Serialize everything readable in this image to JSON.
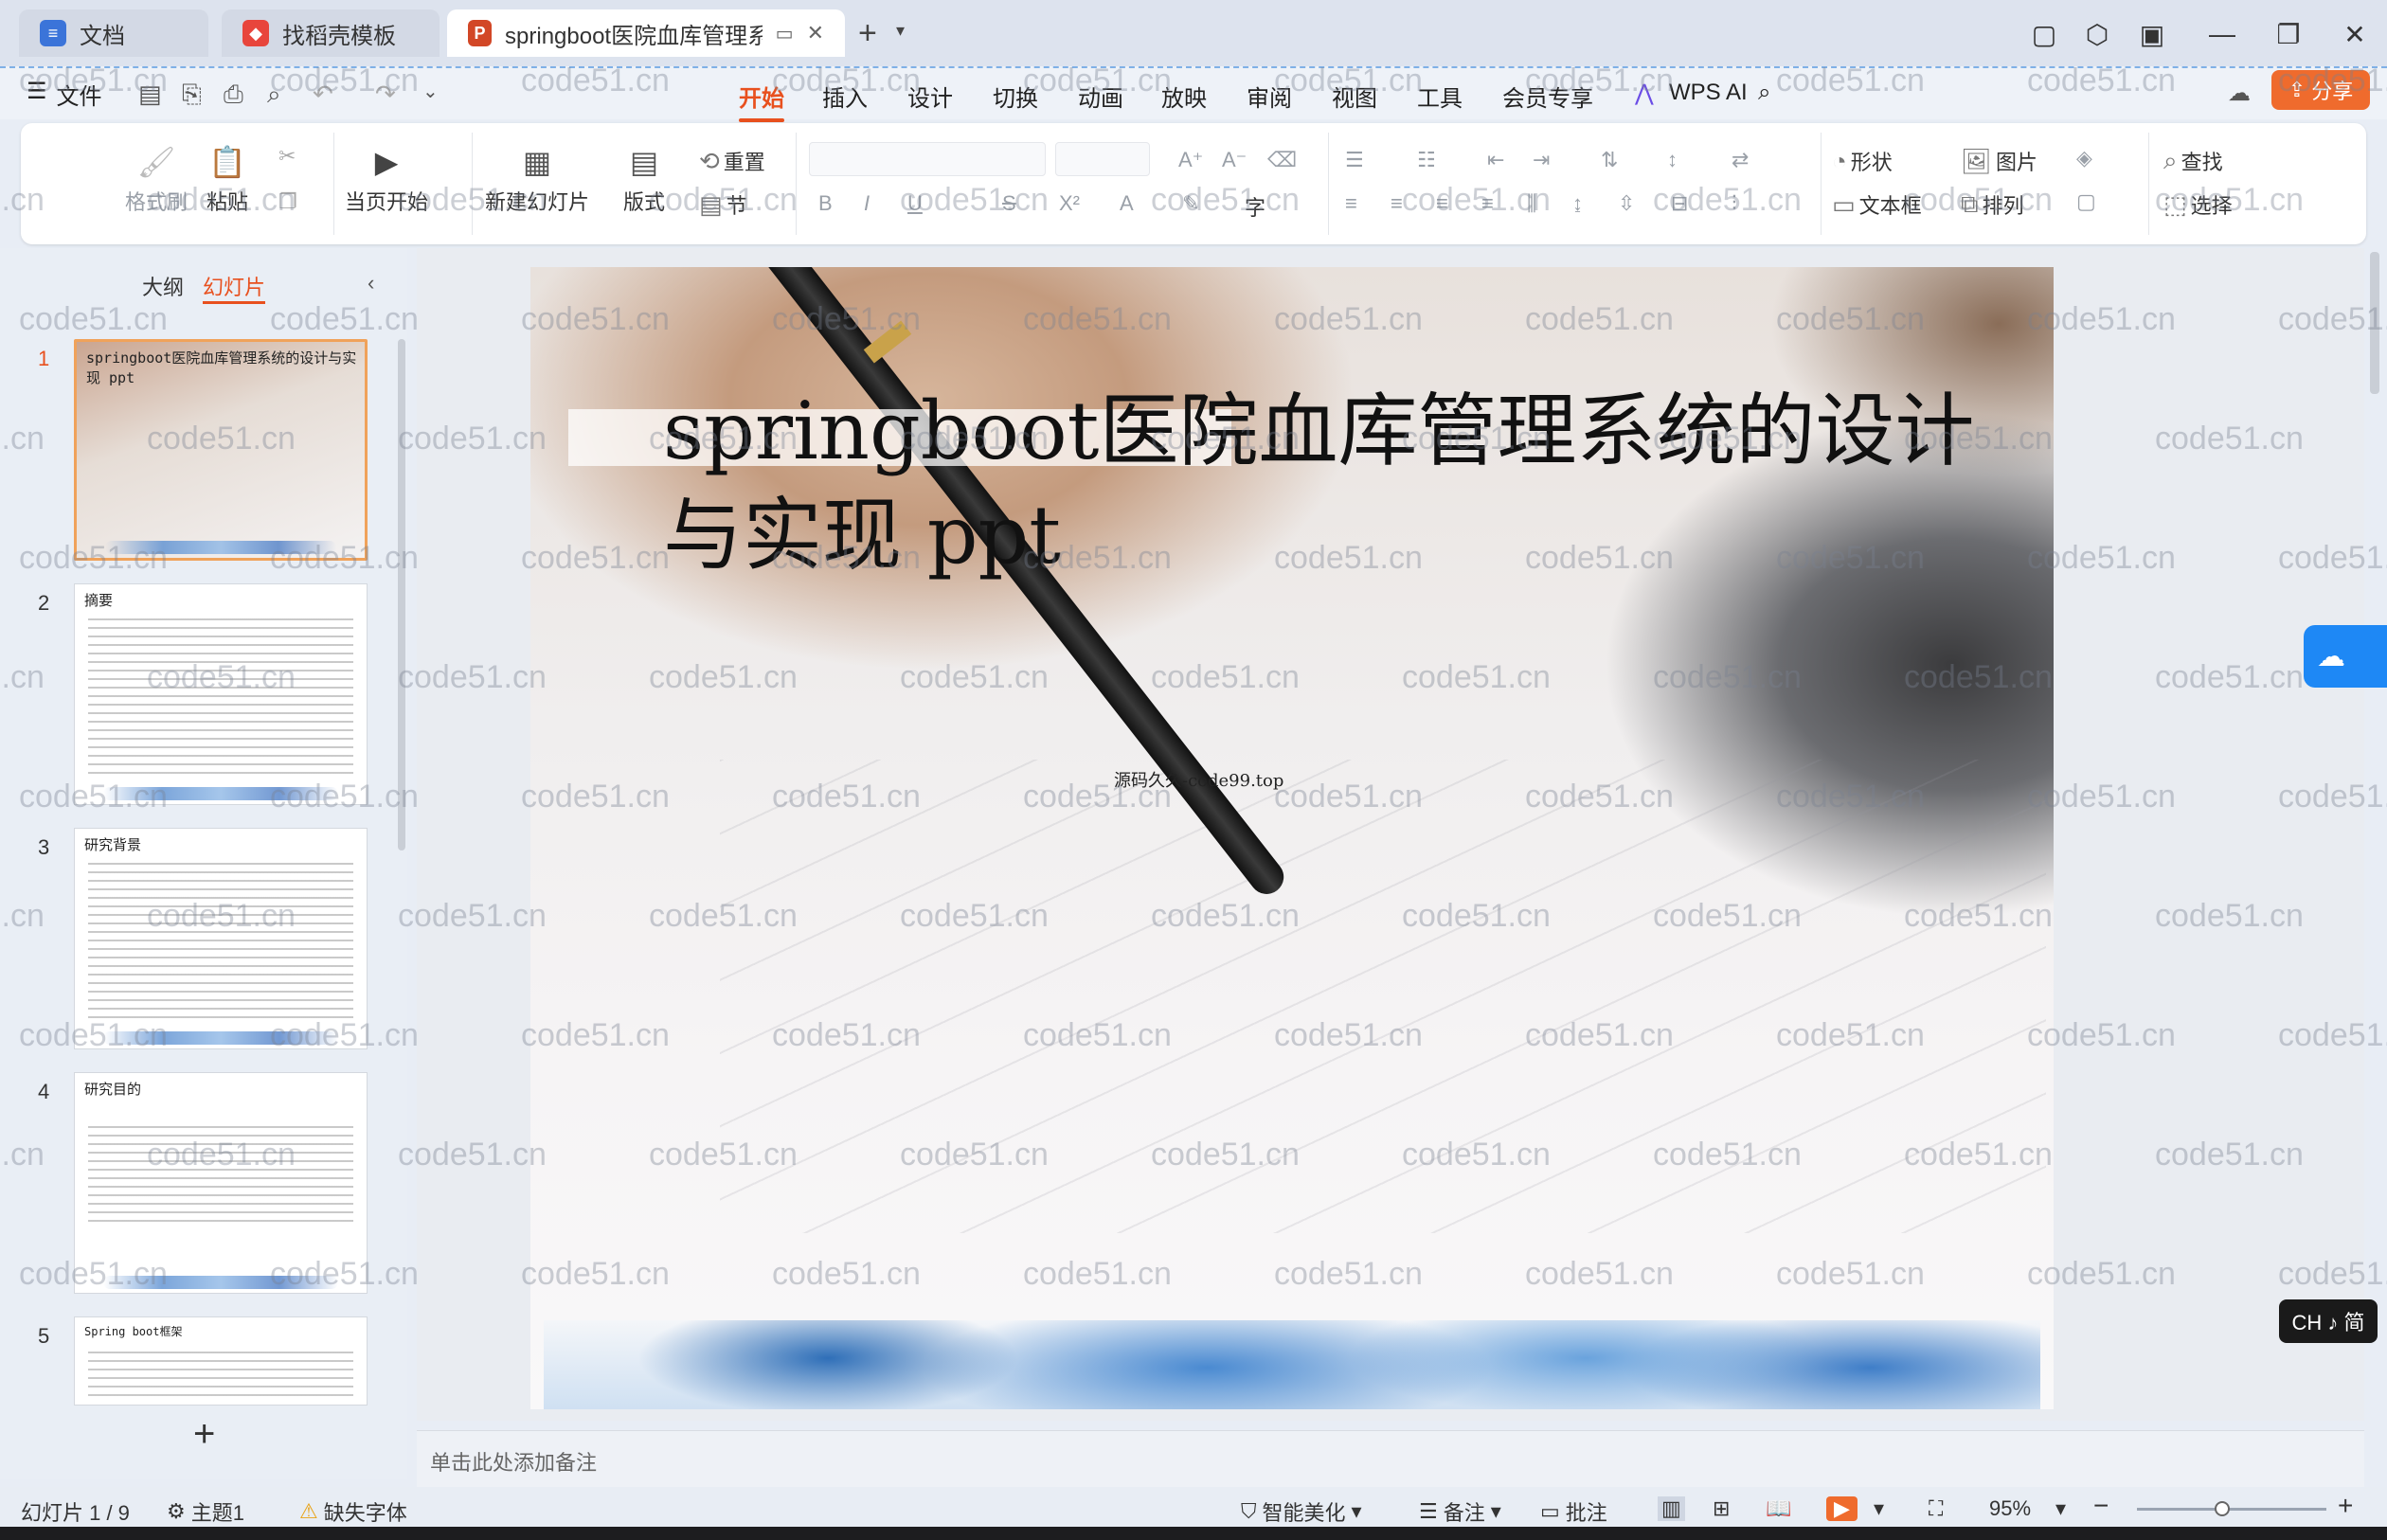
{
  "tabs": [
    {
      "label": "文档",
      "icon": "document-icon",
      "color": "#3b74d9"
    },
    {
      "label": "找稻壳模板",
      "icon": "docer-icon",
      "color": "#e8453c"
    },
    {
      "label": "springboot医院血库管理系统",
      "icon": "ppt-icon",
      "color": "#d24726"
    }
  ],
  "tab_new": "+",
  "file_menu": "文件",
  "menu": [
    "开始",
    "插入",
    "设计",
    "切换",
    "动画",
    "放映",
    "审阅",
    "视图",
    "工具",
    "会员专享",
    "WPS AI"
  ],
  "menu_selected": "开始",
  "share_label": "分享",
  "ribbon": {
    "format_painter": "格式刷",
    "paste": "粘贴",
    "from_current": "当页开始",
    "new_slide": "新建幻灯片",
    "layout": "版式",
    "reset": "重置",
    "section": "节",
    "bold": "B",
    "italic": "I",
    "underline": "U",
    "strike": "S",
    "shape": "形状",
    "picture": "图片",
    "find": "查找",
    "textbox": "文本框",
    "arrange": "排列",
    "select": "选择"
  },
  "panel": {
    "outline_tab": "大纲",
    "slides_tab": "幻灯片",
    "add": "+"
  },
  "thumbnails": [
    {
      "num": "1",
      "title": "springboot医院血库管理系统的设计与实现 ppt"
    },
    {
      "num": "2",
      "title": "摘要"
    },
    {
      "num": "3",
      "title": "研究背景"
    },
    {
      "num": "4",
      "title": "研究目的"
    },
    {
      "num": "5",
      "title": "Spring boot框架"
    }
  ],
  "slide": {
    "title": "springboot医院血库管理系统的设计与实现 ppt",
    "subtitle": "源码久久-code99.top"
  },
  "watermark": "code51.cn",
  "notes_placeholder": "单击此处添加备注",
  "status": {
    "slide_counter": "幻灯片 1 / 9",
    "theme": "主题1",
    "missing_font": "缺失字体",
    "beautify": "智能美化",
    "notes": "备注",
    "comment": "批注",
    "zoom": "95%"
  },
  "ime": "CH ♪ 简",
  "colors": {
    "accent": "#e8501e",
    "share_bg": "#ef6b2d",
    "cloud": "#1e88f5"
  }
}
